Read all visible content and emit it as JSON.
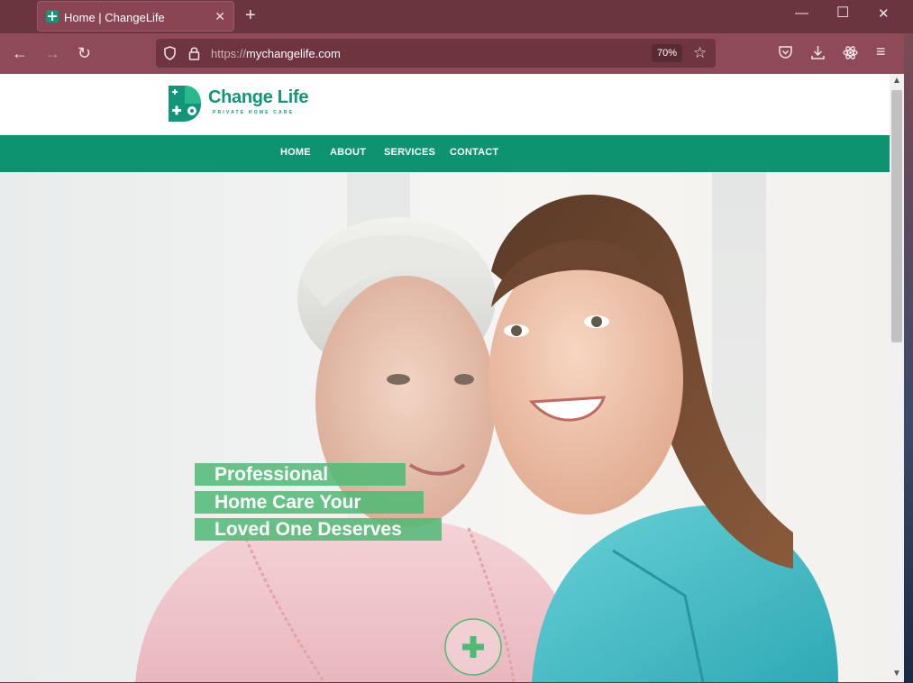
{
  "browser": {
    "tab_title": "Home | ChangeLife",
    "url_protocol": "https://",
    "url_host": "mychangelife.com",
    "zoom": "70%"
  },
  "site": {
    "brand_name": "Change Life",
    "brand_tagline": "PRIVATE HOME CARE",
    "nav": [
      {
        "label": "HOME"
      },
      {
        "label": "ABOUT"
      },
      {
        "label": "SERVICES"
      },
      {
        "label": "CONTACT"
      }
    ],
    "hero": {
      "headline_lines": [
        "Professional",
        "Home Care Your",
        "Loved One Deserves"
      ]
    }
  },
  "colors": {
    "brand_green": "#0e9370",
    "headline_bg": "#4eba74",
    "browser_frame": "#8f4a58"
  }
}
